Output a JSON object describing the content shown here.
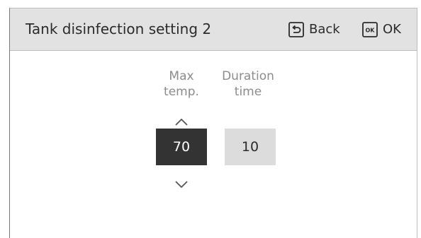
{
  "header": {
    "title": "Tank disinfection setting 2",
    "back_label": "Back",
    "ok_label": "OK",
    "ok_icon_text": "OK",
    "back_icon": "back-return-icon",
    "ok_icon": "ok-key-icon"
  },
  "fields": {
    "max_temp": {
      "label_line1": "Max",
      "label_line2": "temp.",
      "value": "70",
      "state": "selected"
    },
    "duration_time": {
      "label_line1": "Duration",
      "label_line2": "time",
      "value": "10",
      "state": "unselected"
    }
  },
  "icons": {
    "increase": "chevron-up-icon",
    "decrease": "chevron-down-icon"
  },
  "colors": {
    "header_bg": "#e2e2e2",
    "selected_bg": "#333333",
    "unselected_bg": "#dcdcdc",
    "label_gray": "#8c8c8c",
    "text_dark": "#2b2b2b"
  }
}
